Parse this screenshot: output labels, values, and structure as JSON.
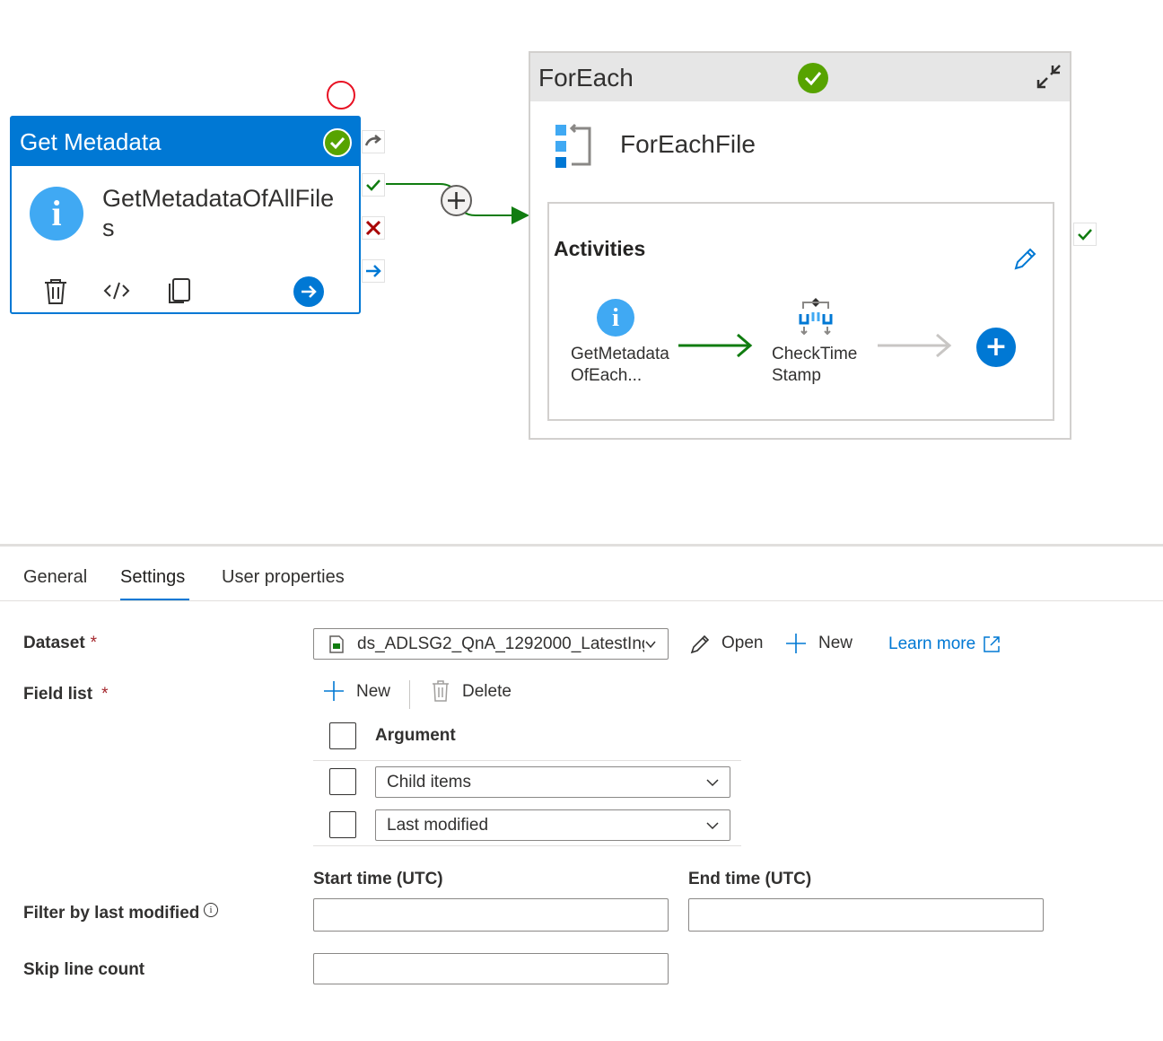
{
  "canvas": {
    "get_metadata": {
      "header": "Get Metadata",
      "name": "GetMetadataOfAllFiles",
      "toolbar": [
        "trash-icon",
        "code-icon",
        "copy-icon",
        "go-icon"
      ]
    },
    "foreach": {
      "header": "ForEach",
      "name": "ForEachFile",
      "activities_title": "Activities",
      "activity_1_name": "GetMetadataOfEach...",
      "activity_2_name": "CheckTimeStamp"
    },
    "colors": {
      "accent": "#0078d4",
      "success": "#57a300",
      "failure": "#a80000",
      "arrow_green": "#107c10",
      "info_blue": "#40a9f3"
    }
  },
  "tabs": [
    "General",
    "Settings",
    "User properties"
  ],
  "active_tab": "Settings",
  "settings": {
    "dataset_label": "Dataset",
    "dataset_value": "ds_ADLSG2_QnA_1292000_LatestIng...",
    "open_label": "Open",
    "new_label": "New",
    "learn_more_label": "Learn more",
    "field_list_label": "Field list",
    "field_new_label": "New",
    "field_delete_label": "Delete",
    "argument_header": "Argument",
    "arguments": [
      "Child items",
      "Last modified"
    ],
    "start_time_label": "Start time (UTC)",
    "end_time_label": "End time (UTC)",
    "filter_label": "Filter by last modified",
    "skip_label": "Skip line count",
    "required_mark": "*"
  }
}
